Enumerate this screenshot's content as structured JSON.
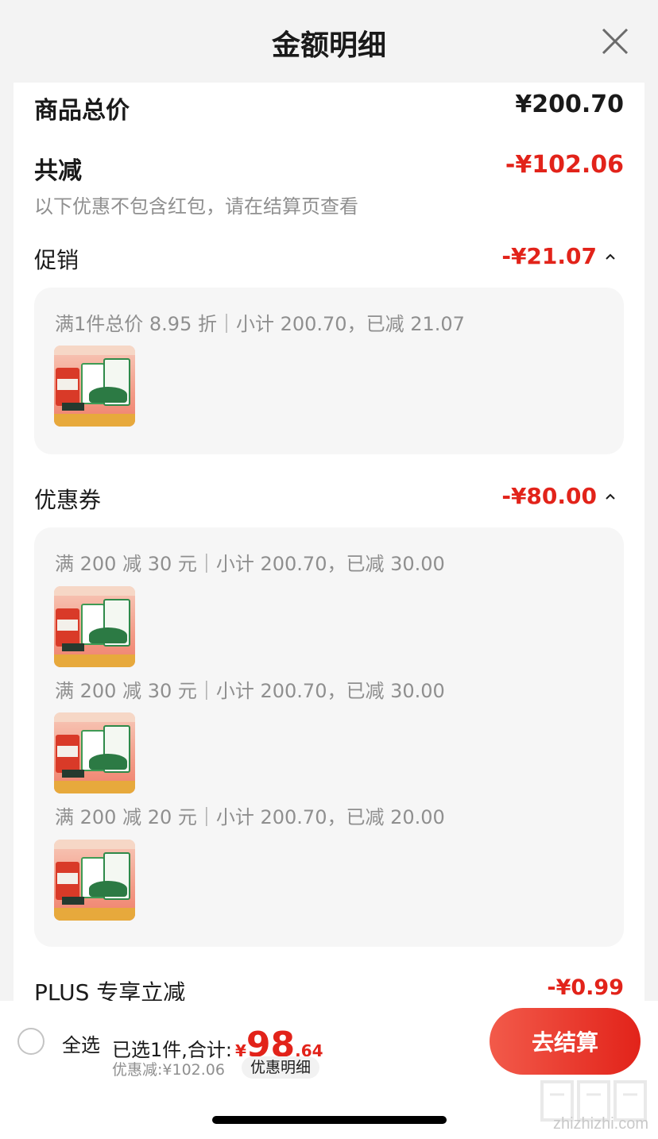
{
  "header": {
    "title": "金额明细"
  },
  "summary": {
    "total_label": "商品总价",
    "total_value": "¥200.70",
    "reduce_label": "共减",
    "reduce_value": "-¥102.06",
    "note": "以下优惠不包含红包，请在结算页查看"
  },
  "promotion": {
    "label": "促销",
    "amount": "-¥21.07",
    "lines": [
      "满1件总价 8.95 折｜小计 200.70，已减 21.07"
    ]
  },
  "coupon": {
    "label": "优惠券",
    "amount": "-¥80.00",
    "lines": [
      "满 200 减 30 元｜小计 200.70，已减 30.00",
      "满 200 减 30 元｜小计 200.70，已减 30.00",
      "满 200 减 20 元｜小计 200.70，已减 20.00"
    ]
  },
  "plus": {
    "label": "PLUS 专享立减",
    "amount": "-¥0.99"
  },
  "bottom_bar": {
    "select_all": "全选",
    "selected_text": "已选1件,合计:",
    "currency": "¥",
    "total_int": "98",
    "total_dec": ".64",
    "discount_text": "优惠减:¥102.06",
    "detail_link": "优惠明细",
    "checkout_label": "去结算"
  },
  "watermark": {
    "text": "zhizhizhi.com"
  },
  "colors": {
    "accent_red": "#e2231a",
    "muted_gray": "#8f8f8f",
    "panel_bg": "#f6f6f6"
  },
  "icons": {
    "close": "close-icon",
    "caret": "chevron-up-icon",
    "product": "product-thumbnail",
    "radio": "radio-unchecked-icon"
  }
}
